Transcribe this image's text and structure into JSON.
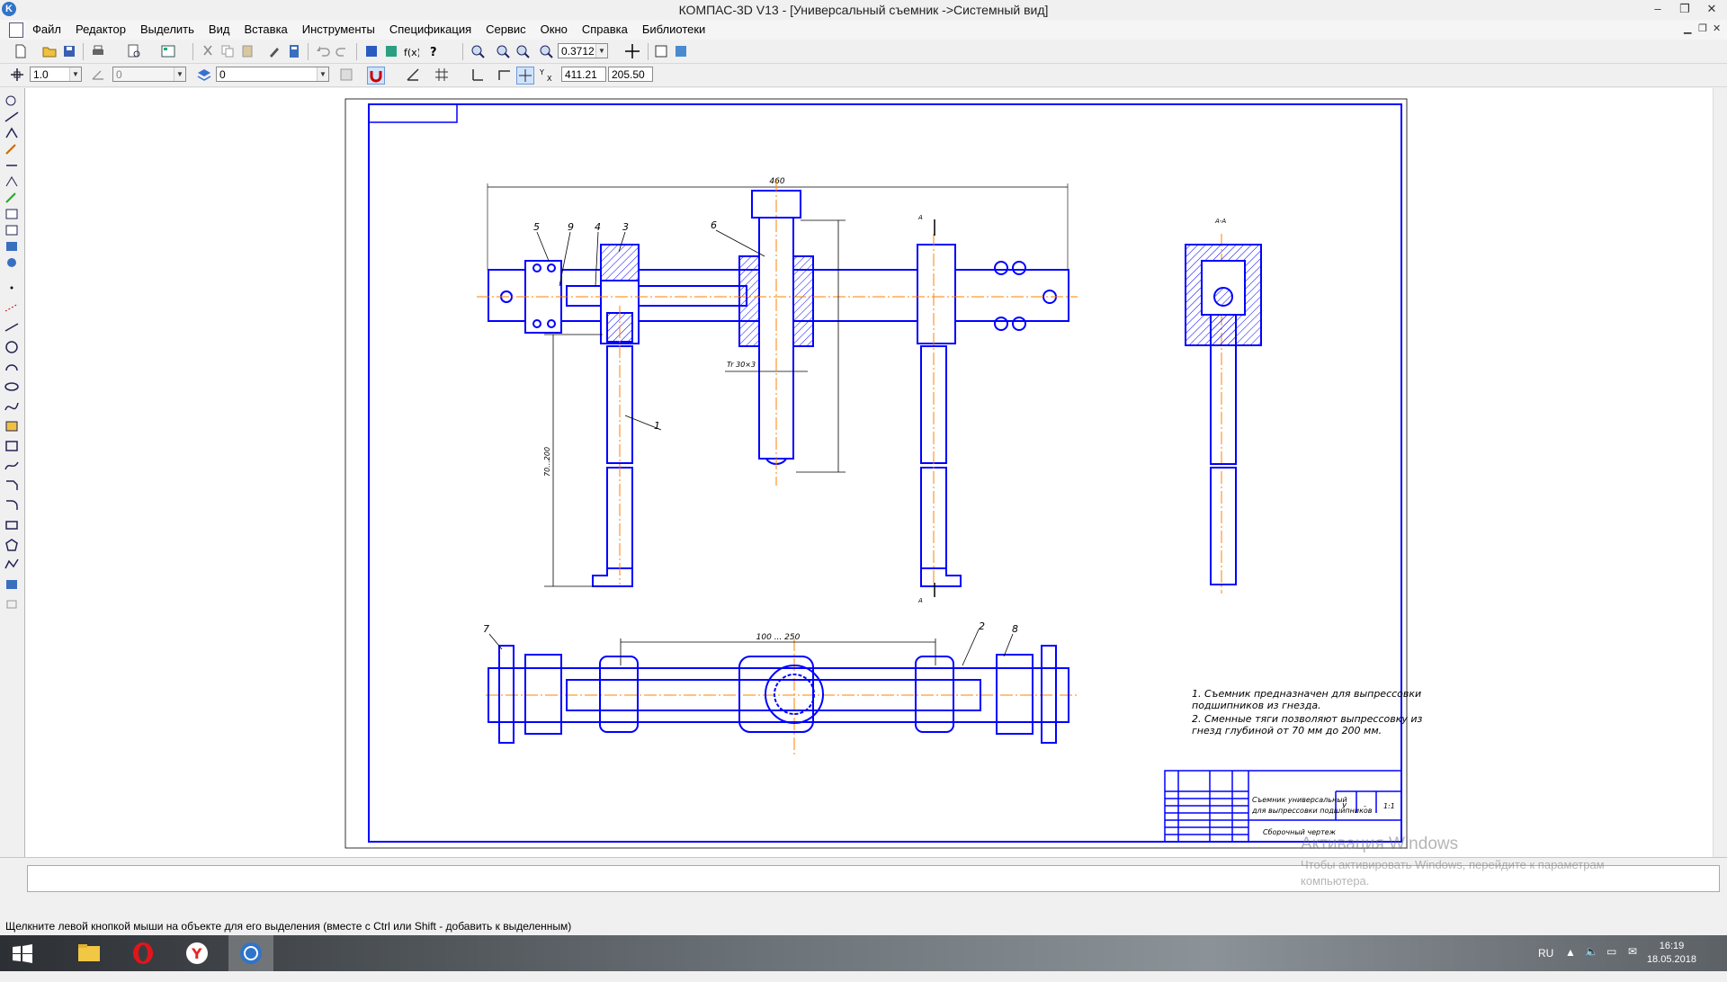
{
  "app": {
    "title": "КОМПАС-3D V13 - [Универсальный съемник ->Системный вид]"
  },
  "menu": {
    "items": [
      "Файл",
      "Редактор",
      "Выделить",
      "Вид",
      "Вставка",
      "Инструменты",
      "Спецификация",
      "Сервис",
      "Окно",
      "Справка",
      "Библиотеки"
    ]
  },
  "toolbar": {
    "zoom_value": "0.3712"
  },
  "toolbar2": {
    "step_value": "1.0",
    "angle_value": "0",
    "layer_value": "0",
    "coord_x": "411.21",
    "coord_y": "205.50"
  },
  "drawing": {
    "overall_dim": "460",
    "dim_range_horizontal": "100 ... 250",
    "dim_range_vertical": "70...200",
    "thread_label": "Tr 30×3",
    "section_label": "А-А",
    "section_mark": "А",
    "leaders": [
      "1",
      "2",
      "3",
      "4",
      "5",
      "6",
      "7",
      "8",
      "9"
    ],
    "notes": [
      "1. Съемник предназначен для выпрессовки",
      "подшипников из гнезда.",
      "2. Сменные тяги позволяют выпрессовку из",
      "гнезд глубиной от 70 мм до 200 мм."
    ],
    "title_block": {
      "name_line1": "Съемник универсальный",
      "name_line2": "для выпрессовки подшипников",
      "doc_type": "Сборочный чертеж",
      "letter": "У",
      "mass": "-",
      "scale": "1:1"
    }
  },
  "status": {
    "hint": "Щелкните левой кнопкой мыши на объекте для его выделения (вместе с Ctrl или Shift - добавить к выделенным)"
  },
  "activation": {
    "title": "Активация Windows",
    "line1": "Чтобы активировать Windows, перейдите к параметрам",
    "line2": "компьютера."
  },
  "taskbar": {
    "lang": "RU",
    "time": "16:19",
    "date": "18.05.2018"
  },
  "colors": {
    "drawing_line": "#0000ff",
    "axis_line": "#ff8000",
    "dimension": "#000000"
  }
}
